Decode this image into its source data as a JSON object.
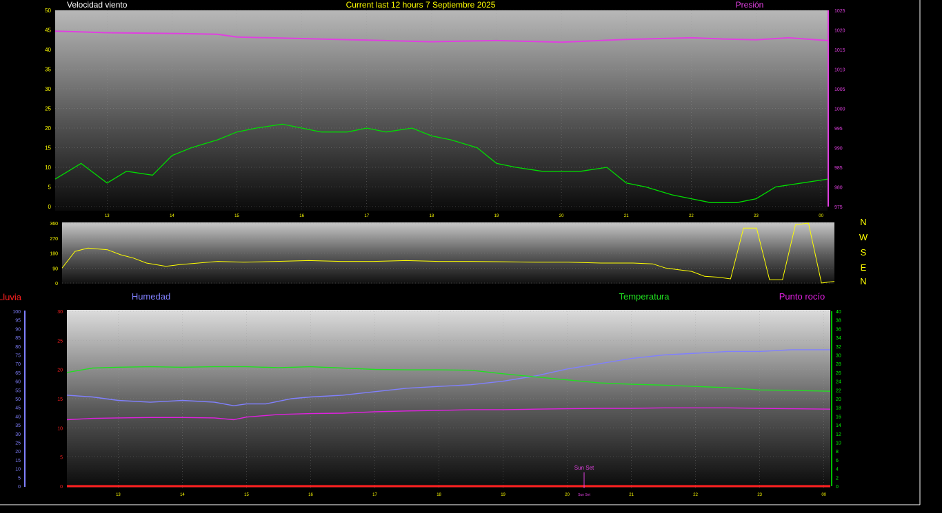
{
  "header": {
    "wind_label": "Velocidad viento",
    "title": "Current last 12 hours 7 Septiembre 2025",
    "pressure_label": "Presión"
  },
  "compass": [
    "N",
    "W",
    "S",
    "E",
    "N"
  ],
  "bottom_labels": {
    "rain": "Lluvia",
    "humidity": "Humedad",
    "temperature": "Temperatura",
    "dewpoint": "Punto rocío",
    "sunset": "Sun Set",
    "sunset_axis": "Sun Set"
  },
  "colors": {
    "wind_gust": "#ffffff",
    "wind_speed": "#c8ffc8",
    "wind_avg": "#00dd00",
    "pressure": "#e040e0",
    "direction": "#ffff00",
    "rain": "#ff2020",
    "humidity": "#8080ff",
    "temperature": "#20e020",
    "dewpoint": "#e020e0",
    "title": "#ffff00",
    "compass": "#ffff00"
  },
  "x_ticks": [
    "13",
    "14",
    "15",
    "16",
    "17",
    "18",
    "19",
    "20",
    "21",
    "22",
    "23",
    "00"
  ],
  "chart_data": [
    {
      "type": "line",
      "title": "Current last 12 hours 7 Septiembre 2025",
      "ylim_left": [
        0,
        50
      ],
      "left_ticks": [
        "0",
        "5",
        "10",
        "15",
        "20",
        "25",
        "30",
        "35",
        "40",
        "45",
        "50"
      ],
      "ylim_right": [
        975,
        1025
      ],
      "right_ticks": [
        "975",
        "980",
        "985",
        "990",
        "995",
        "1000",
        "1005",
        "1010",
        "1015",
        "1020",
        "1025"
      ],
      "x_range_hours": [
        12.2,
        24.1
      ],
      "series": [
        {
          "name": "Velocidad viento",
          "axis": "left",
          "x": [
            12.2,
            12.6,
            13,
            13.3,
            13.7,
            14,
            14.3,
            14.7,
            15,
            15.3,
            15.7,
            16,
            16.3,
            16.7,
            17,
            17.3,
            17.7,
            18,
            18.3,
            18.7,
            19,
            19.3,
            19.7,
            20,
            20.3,
            20.7,
            21,
            21.3,
            21.7,
            22,
            22.3,
            22.7,
            23,
            23.3,
            23.7,
            24.1
          ],
          "y": [
            7,
            11,
            6,
            9,
            8,
            13,
            15,
            17,
            19,
            20,
            21,
            20,
            19,
            19,
            20,
            19,
            20,
            18,
            17,
            15,
            11,
            10,
            9,
            9,
            9,
            10,
            6,
            5,
            3,
            2,
            1,
            1,
            2,
            5,
            6,
            7
          ]
        },
        {
          "name": "Presión",
          "axis": "right",
          "x": [
            12.2,
            13,
            14,
            14.7,
            15,
            16,
            17,
            18,
            19,
            20,
            21,
            22,
            22.5,
            23,
            23.5,
            24.1
          ],
          "y": [
            1019.7,
            1019.3,
            1019.1,
            1018.9,
            1018.2,
            1017.8,
            1017.4,
            1017.0,
            1017.3,
            1016.9,
            1017.6,
            1018.0,
            1017.7,
            1017.5,
            1018.0,
            1017.3
          ]
        }
      ]
    },
    {
      "type": "line",
      "ylim": [
        0,
        360
      ],
      "left_ticks": [
        "0",
        "90",
        "180",
        "270",
        "360"
      ],
      "x_range_hours": [
        12.2,
        24.1
      ],
      "series": [
        {
          "name": "Dirección",
          "axis": "left",
          "x": [
            12.2,
            12.4,
            12.6,
            12.9,
            13.1,
            13.3,
            13.5,
            13.8,
            14,
            14.3,
            14.6,
            15,
            15.5,
            16,
            16.5,
            17,
            17.5,
            18,
            18.5,
            19,
            19.5,
            20,
            20.5,
            21,
            21.3,
            21.5,
            21.7,
            21.9,
            22.1,
            22.3,
            22.5,
            22.7,
            22.9,
            23.1,
            23.3,
            23.5,
            23.7,
            23.9,
            24.1
          ],
          "y": [
            90,
            190,
            210,
            200,
            170,
            150,
            120,
            100,
            110,
            120,
            130,
            125,
            130,
            135,
            130,
            130,
            135,
            130,
            130,
            128,
            125,
            125,
            120,
            120,
            115,
            90,
            80,
            70,
            40,
            35,
            25,
            330,
            330,
            20,
            20,
            350,
            360,
            0,
            10
          ]
        }
      ]
    },
    {
      "type": "line",
      "ylim_rain": [
        0,
        30
      ],
      "rain_ticks": [
        "0",
        "5",
        "10",
        "15",
        "20",
        "25",
        "30"
      ],
      "ylim_humidity": [
        0,
        100
      ],
      "humidity_ticks": [
        "0",
        "5",
        "10",
        "15",
        "20",
        "25",
        "30",
        "35",
        "40",
        "45",
        "50",
        "55",
        "60",
        "65",
        "70",
        "75",
        "80",
        "85",
        "90",
        "95",
        "100"
      ],
      "ylim_temp": [
        0,
        40
      ],
      "temp_ticks": [
        "0",
        "2",
        "4",
        "6",
        "8",
        "10",
        "12",
        "14",
        "16",
        "18",
        "20",
        "22",
        "24",
        "26",
        "28",
        "30",
        "32",
        "34",
        "36",
        "38",
        "40"
      ],
      "x_range_hours": [
        12.2,
        24.1
      ],
      "series": [
        {
          "name": "Lluvia",
          "axis": "rain",
          "x": [
            12.2,
            24.1
          ],
          "y": [
            0,
            0
          ]
        },
        {
          "name": "Humedad",
          "axis": "humidity",
          "x": [
            12.2,
            12.6,
            13,
            13.5,
            14,
            14.5,
            14.8,
            15,
            15.3,
            15.7,
            16,
            16.5,
            17,
            17.5,
            18,
            18.5,
            19,
            19.5,
            20,
            20.5,
            21,
            21.5,
            22,
            22.5,
            23,
            23.5,
            24.1
          ],
          "y": [
            52,
            51,
            49,
            48,
            49,
            48,
            46,
            47,
            47,
            50,
            51,
            52,
            54,
            56,
            57,
            58,
            60,
            63,
            67,
            70,
            73,
            75,
            76,
            77,
            77,
            78,
            78
          ]
        },
        {
          "name": "Temperatura",
          "axis": "temp",
          "x": [
            12.2,
            12.6,
            13,
            13.5,
            14,
            14.5,
            15,
            15.5,
            16,
            16.5,
            17,
            17.5,
            18,
            18.5,
            19,
            19.5,
            20,
            20.5,
            21,
            21.5,
            22,
            22.5,
            23,
            23.5,
            24.1
          ],
          "y": [
            26.0,
            27.0,
            27.2,
            27.3,
            27.2,
            27.3,
            27.3,
            27.1,
            27.3,
            27.0,
            26.7,
            26.6,
            26.6,
            26.5,
            25.7,
            25.0,
            24.3,
            23.6,
            23.3,
            23.1,
            22.8,
            22.5,
            22.0,
            21.9,
            21.7
          ]
        },
        {
          "name": "Punto rocío",
          "axis": "temp",
          "x": [
            12.2,
            12.6,
            13,
            13.5,
            14,
            14.5,
            14.8,
            15,
            15.5,
            16,
            16.5,
            17,
            17.5,
            18,
            18.5,
            19,
            19.5,
            20,
            20.5,
            21,
            21.5,
            22,
            22.5,
            23,
            23.5,
            24.1
          ],
          "y": [
            15.2,
            15.5,
            15.6,
            15.7,
            15.7,
            15.6,
            15.2,
            15.8,
            16.4,
            16.6,
            16.7,
            17.0,
            17.2,
            17.3,
            17.5,
            17.5,
            17.6,
            17.7,
            17.8,
            17.8,
            17.9,
            17.9,
            17.9,
            17.8,
            17.7,
            17.6
          ]
        }
      ],
      "annotations": [
        {
          "text": "Sun Set",
          "x": 20.3
        }
      ]
    }
  ]
}
